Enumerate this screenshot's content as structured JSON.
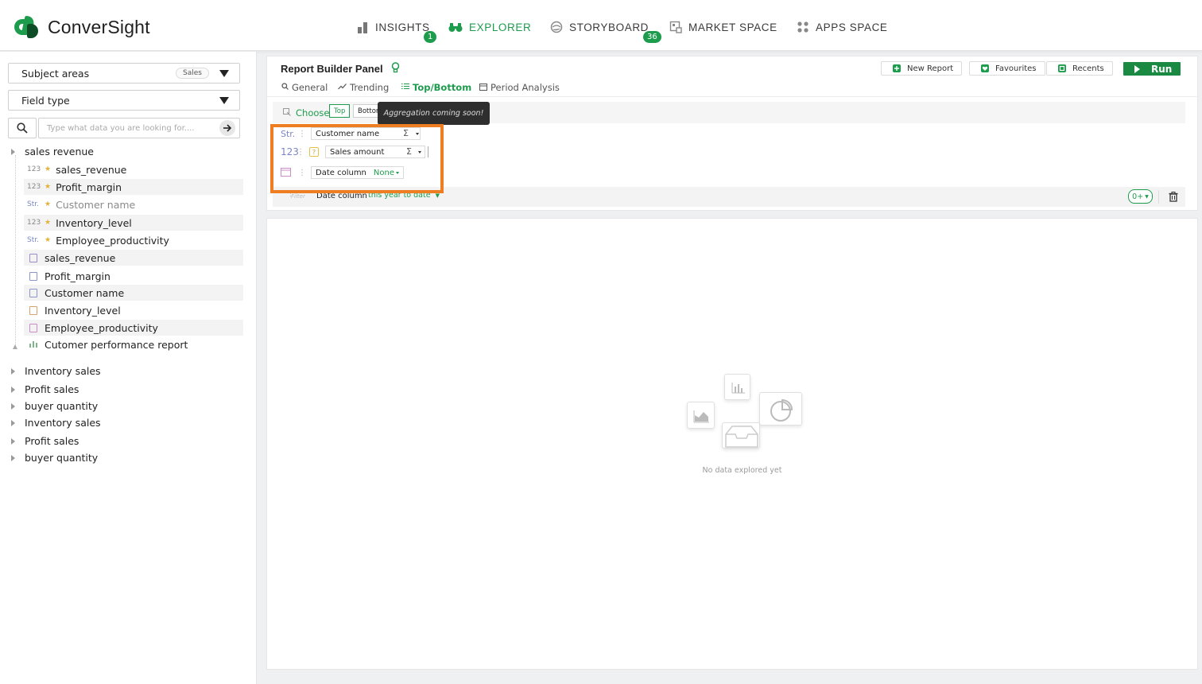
{
  "app": {
    "brand": "ConverSight"
  },
  "nav": [
    {
      "label": "INSIGHTS",
      "badge": "1"
    },
    {
      "label": "EXPLORER",
      "badge": ""
    },
    {
      "label": "STORYBOARD",
      "badge": "36"
    },
    {
      "label": "MARKET SPACE",
      "badge": ""
    },
    {
      "label": "APPS SPACE",
      "badge": ""
    }
  ],
  "left": {
    "subject_areas": {
      "label": "Subject areas",
      "chip": "Sales"
    },
    "field_type": {
      "label": "Field type"
    },
    "search": {
      "placeholder": "Type what data you are looking for...."
    },
    "tree": {
      "root": "sales revenue",
      "children": [
        {
          "type": "123",
          "star": true,
          "label": "sales_revenue"
        },
        {
          "type": "123",
          "star": true,
          "label": "Profit_margin"
        },
        {
          "type": "Str.",
          "star": true,
          "label": "Customer name"
        },
        {
          "type": "123",
          "star": true,
          "label": "Inventory_level"
        },
        {
          "type": "Str.",
          "star": true,
          "label": "Employee_productivity"
        },
        {
          "type": "",
          "star": false,
          "label": "sales_revenue"
        },
        {
          "type": "",
          "star": false,
          "label": "Profit_margin"
        },
        {
          "type": "",
          "star": false,
          "label": "Customer name"
        },
        {
          "type": "",
          "star": false,
          "label": "Inventory_level"
        },
        {
          "type": "",
          "star": false,
          "label": "Employee_productivity"
        },
        {
          "type": "",
          "star": false,
          "label": "Cutomer performance report"
        }
      ],
      "others": [
        "Inventory sales",
        "Profit sales",
        "buyer quantity",
        "Inventory sales",
        "Profit sales",
        "buyer quantity"
      ]
    }
  },
  "panel": {
    "title": "Report Builder Panel",
    "toolbar": {
      "new_report": "New Report",
      "favourites": "Favourites",
      "recents": "Recents",
      "run": "Run"
    },
    "tabs": [
      "General",
      "Trending",
      "Top/Bottom",
      "Period Analysis"
    ],
    "choose": {
      "label": "Choose",
      "top": "Top",
      "bottom": "Bottom"
    },
    "tooltip": "Aggregation coming soon!",
    "fields": [
      {
        "type": "Str.",
        "name": "Customer name",
        "agg": "Σ"
      },
      {
        "type": "123",
        "name": "Sales amount",
        "agg": "Σ"
      },
      {
        "type": "",
        "name": "Date column",
        "value": "None"
      }
    ],
    "filter": {
      "label": "Filter",
      "column": "Date column",
      "value": "this year to date",
      "count": "0+"
    },
    "empty_state": "No data explored yet"
  },
  "colors": {
    "brand_green": "#1e9c4d",
    "highlight_orange": "#ef7d22"
  }
}
